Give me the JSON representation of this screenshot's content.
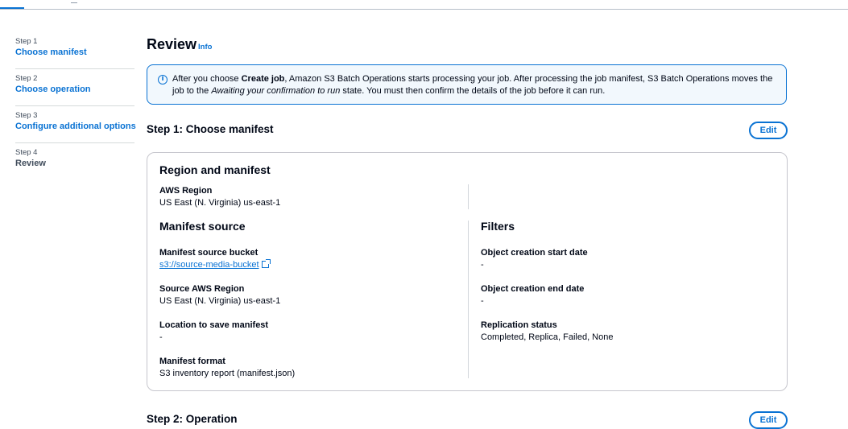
{
  "wizard": {
    "steps": [
      {
        "num": "Step 1",
        "title": "Choose manifest"
      },
      {
        "num": "Step 2",
        "title": "Choose operation"
      },
      {
        "num": "Step 3",
        "title": "Configure additional options"
      },
      {
        "num": "Step 4",
        "title": "Review"
      }
    ]
  },
  "page": {
    "title": "Review",
    "info": "Info"
  },
  "alert": {
    "p1": "After you choose ",
    "b1": "Create job",
    "p2": ", Amazon S3 Batch Operations starts processing your job. After processing the job manifest, S3 Batch Operations moves the job to the ",
    "i1": "Awaiting your confirmation to run",
    "p3": " state. You must then confirm the details of the job before it can run."
  },
  "step1": {
    "title": "Step 1: Choose manifest",
    "edit": "Edit",
    "region_heading": "Region and manifest",
    "aws_region_label": "AWS Region",
    "aws_region_value": "US East (N. Virginia) us-east-1",
    "manifest_source_heading": "Manifest source",
    "bucket_label": "Manifest source bucket",
    "bucket_value": "s3://source-media-bucket",
    "source_region_label": "Source AWS Region",
    "source_region_value": "US East (N. Virginia) us-east-1",
    "save_location_label": "Location to save manifest",
    "save_location_value": "-",
    "format_label": "Manifest format",
    "format_value": "S3 inventory report (manifest.json)",
    "filters_heading": "Filters",
    "start_date_label": "Object creation start date",
    "start_date_value": "-",
    "end_date_label": "Object creation end date",
    "end_date_value": "-",
    "replication_label": "Replication status",
    "replication_value": "Completed, Replica, Failed, None"
  },
  "step2": {
    "title": "Step 2: Operation",
    "edit": "Edit"
  },
  "colors": {
    "accent": "#0972d3",
    "text": "#000716",
    "alert_bg": "#f2f8fd"
  }
}
